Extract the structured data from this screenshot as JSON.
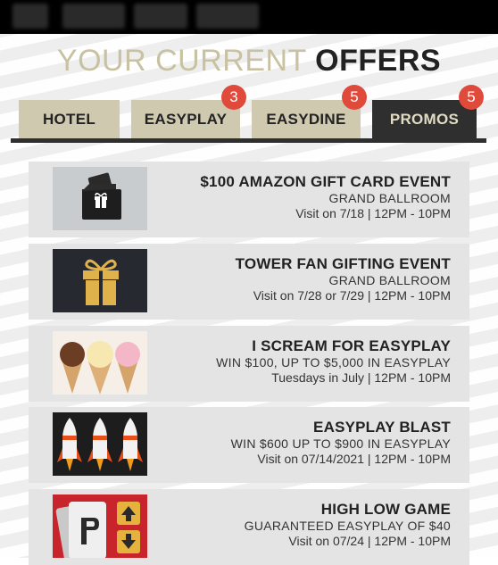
{
  "header": {
    "title_light": "YOUR CURRENT ",
    "title_bold": "OFFERS"
  },
  "tabs": [
    {
      "label": "HOTEL",
      "badge": ""
    },
    {
      "label": "EASYPLAY",
      "badge": "3"
    },
    {
      "label": "EASYDINE",
      "badge": "5"
    },
    {
      "label": "PROMOS",
      "badge": "5"
    }
  ],
  "active_tab": "PROMOS",
  "offers": [
    {
      "title": "$100 AMAZON GIFT CARD EVENT",
      "subtitle": "GRAND BALLROOM",
      "details": "Visit on 7/18 | 12PM - 10PM",
      "icon": "gift-card-icon"
    },
    {
      "title": "TOWER FAN GIFTING EVENT",
      "subtitle": "GRAND BALLROOM",
      "details": "Visit on 7/28 or 7/29 | 12PM - 10PM",
      "icon": "gift-box-icon"
    },
    {
      "title": "I SCREAM FOR EASYPLAY",
      "subtitle": "WIN $100, UP TO $5,000 IN EASYPLAY",
      "details": "Tuesdays in July | 12PM - 10PM",
      "icon": "ice-cream-icon"
    },
    {
      "title": "EASYPLAY BLAST",
      "subtitle": "WIN $600 UP TO $900 IN EASYPLAY",
      "details": "Visit on 07/14/2021 | 12PM - 10PM",
      "icon": "rockets-icon"
    },
    {
      "title": "HIGH LOW GAME",
      "subtitle": "GUARANTEED EASYPLAY OF $40",
      "details": "Visit on 07/24 | 12PM - 10PM",
      "icon": "high-low-cards-icon"
    }
  ],
  "colors": {
    "accent_khaki": "#cfc9b0",
    "dark": "#2f2f2f",
    "badge_red": "#e04a3b",
    "card_bg": "#e4e4e4"
  }
}
